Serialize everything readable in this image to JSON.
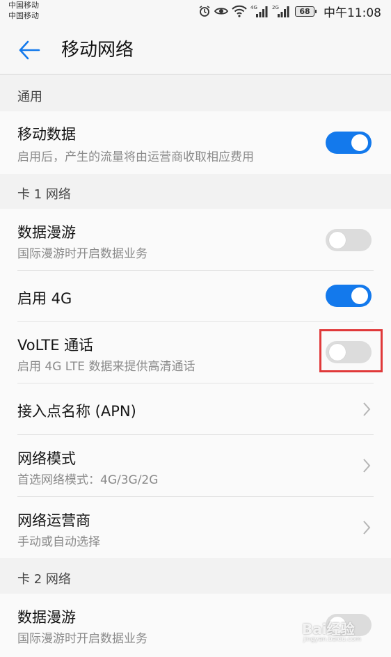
{
  "status_bar": {
    "carrier_1": "中国移动",
    "carrier_2": "中国移动",
    "signal_1_label": "4G",
    "signal_2_label": "2G",
    "battery": "68",
    "time": "中午11:08"
  },
  "app_bar": {
    "title": "移动网络"
  },
  "sections": {
    "general": {
      "header": "通用",
      "mobile_data": {
        "title": "移动数据",
        "subtitle": "启用后，产生的流量将由运营商收取相应费用",
        "enabled": true
      }
    },
    "card1": {
      "header": "卡 1 网络",
      "roaming": {
        "title": "数据漫游",
        "subtitle": "国际漫游时开启数据业务",
        "enabled": false
      },
      "enable_4g": {
        "title": "启用 4G",
        "enabled": true
      },
      "volte": {
        "title": "VoLTE 通话",
        "subtitle": "启用 4G LTE 数据来提供高清通话",
        "enabled": false
      },
      "apn": {
        "title": "接入点名称 (APN)"
      },
      "network_mode": {
        "title": "网络模式",
        "subtitle": "首选网络模式：4G/3G/2G"
      },
      "operator": {
        "title": "网络运营商",
        "subtitle": "手动或自动选择"
      }
    },
    "card2": {
      "header": "卡 2 网络",
      "roaming": {
        "title": "数据漫游",
        "subtitle": "国际漫游时开启数据业务",
        "enabled": false
      }
    }
  },
  "watermark": {
    "text": "Bai经验",
    "sub": "jingyan.baidu.com"
  },
  "colors": {
    "accent": "#1379ec",
    "toggle_off": "#dcdcdc",
    "highlight": "#e0393a"
  }
}
